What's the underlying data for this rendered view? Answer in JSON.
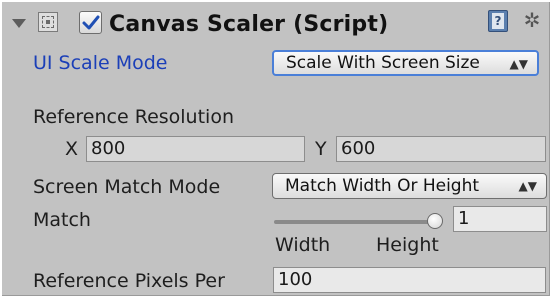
{
  "component": {
    "title": "Canvas Scaler (Script)",
    "enabled": true,
    "icons": {
      "foldout": "foldout-triangle-icon",
      "component": "canvas-scaler-component-icon",
      "help": "help-book-icon",
      "settings": "gear-icon"
    },
    "help_glyph": "?",
    "settings_glyph": "✲"
  },
  "ui_scale_mode": {
    "label": "UI Scale Mode",
    "value": "Scale With Screen Size"
  },
  "reference_resolution": {
    "label": "Reference Resolution",
    "x_label": "X",
    "x_value": "800",
    "y_label": "Y",
    "y_value": "600"
  },
  "screen_match_mode": {
    "label": "Screen Match Mode",
    "value": "Match Width Or Height"
  },
  "match": {
    "label": "Match",
    "slider_fraction": 1,
    "value": "1",
    "left_caption": "Width",
    "right_caption": "Height"
  },
  "reference_pixels": {
    "label": "Reference Pixels Per",
    "value": "100"
  },
  "colors": {
    "panel_bg": "#c2c2c2",
    "label_highlight": "#1b3fb8",
    "focus_border": "#4a7fd8"
  }
}
